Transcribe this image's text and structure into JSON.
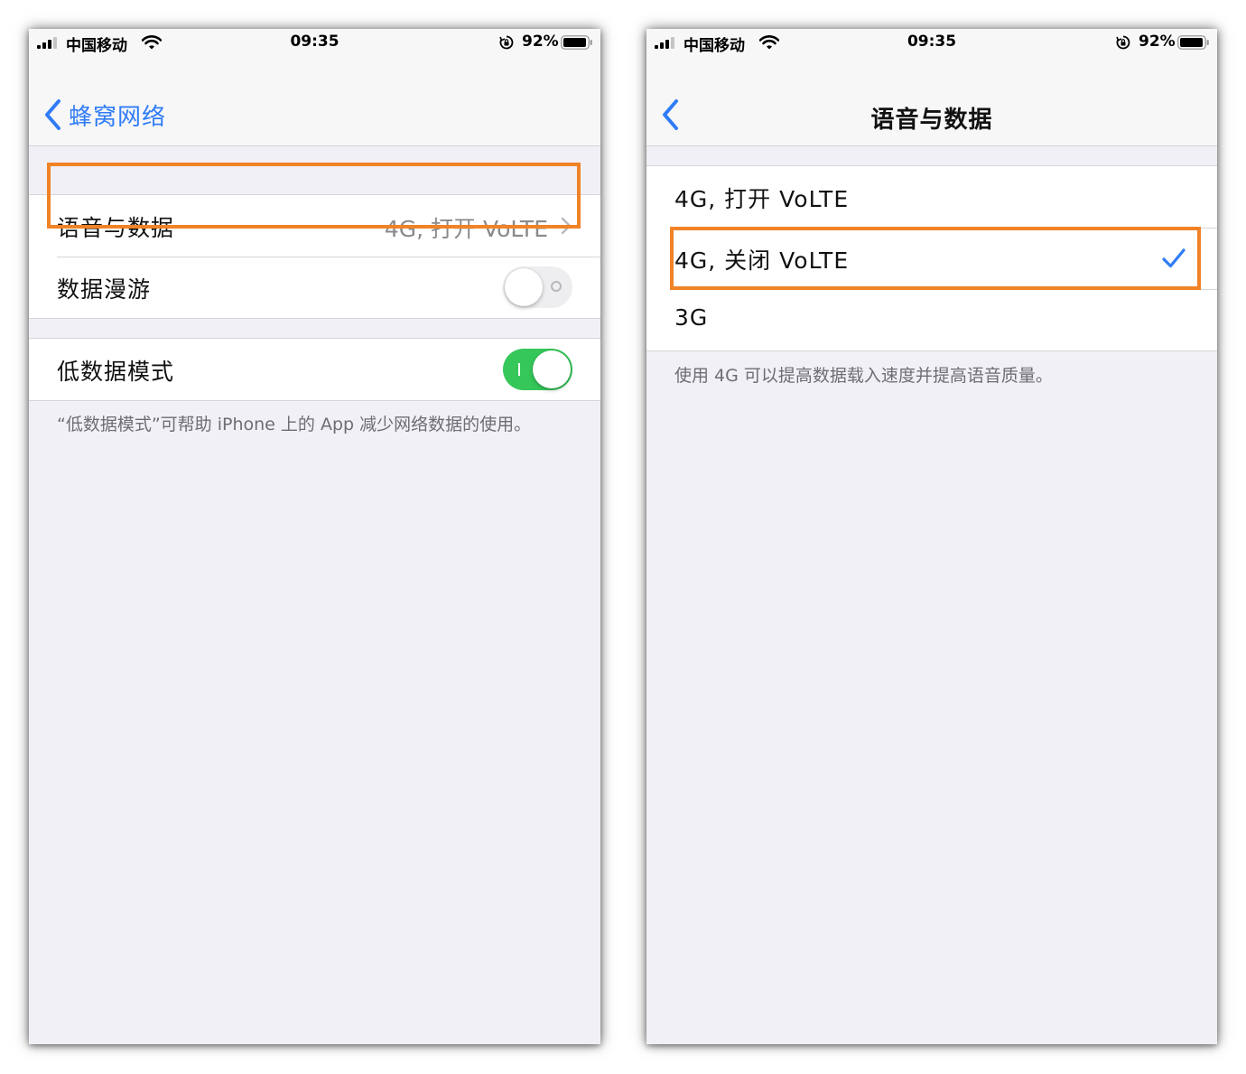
{
  "colors": {
    "accent": "#2f7cf6",
    "switch_on": "#35c759",
    "highlight": "#f08326",
    "background": "#f1f0f6"
  },
  "left_screen": {
    "status_bar": {
      "carrier": "中国移动",
      "time": "09:35",
      "battery": "92%"
    },
    "nav": {
      "back_label": "蜂窝网络",
      "back_icon": "chevron-left-icon"
    },
    "cells": {
      "voice_data": {
        "label": "语音与数据",
        "value": "4G, 打开 VoLTE"
      },
      "data_roaming": {
        "label": "数据漫游",
        "switch_on": false
      },
      "low_data_mode": {
        "label": "低数据模式",
        "switch_on": true
      }
    },
    "footer": "“低数据模式”可帮助 iPhone 上的 App 减少网络数据的使用。"
  },
  "right_screen": {
    "status_bar": {
      "carrier": "中国移动",
      "time": "09:35",
      "battery": "92%"
    },
    "nav": {
      "title": "语音与数据",
      "back_icon": "chevron-left-icon"
    },
    "options": [
      {
        "label": "4G, 打开 VoLTE",
        "selected": false
      },
      {
        "label": "4G, 关闭 VoLTE",
        "selected": true
      },
      {
        "label": "3G",
        "selected": false
      }
    ],
    "footer": "使用 4G 可以提高数据载入速度并提高语音质量。"
  }
}
